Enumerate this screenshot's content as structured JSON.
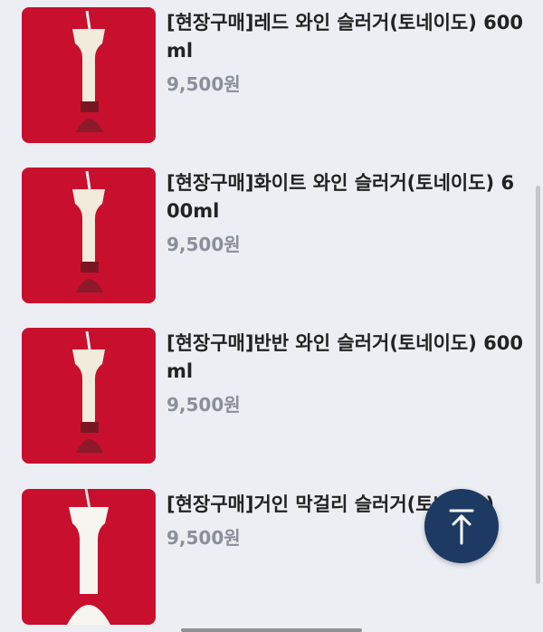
{
  "products": [
    {
      "title": "[현장구매]레드 와인 슬러거(토네이도) 600ml",
      "price": "9,500원",
      "variant": "red"
    },
    {
      "title": "[현장구매]화이트 와인 슬러거(토네이도) 600ml",
      "price": "9,500원",
      "variant": "red"
    },
    {
      "title": "[현장구매]반반 와인 슬러거(토네이도) 600ml",
      "price": "9,500원",
      "variant": "red"
    },
    {
      "title": "[현장구매]거인 막걸리 슬러거(토네이도)",
      "price": "9,500원",
      "variant": "white"
    }
  ],
  "icons": {
    "scroll_top": "arrow-up-icon"
  },
  "colors": {
    "thumb_bg": "#c8102e",
    "price": "#8a8f9a",
    "fab": "#1d3a63"
  }
}
